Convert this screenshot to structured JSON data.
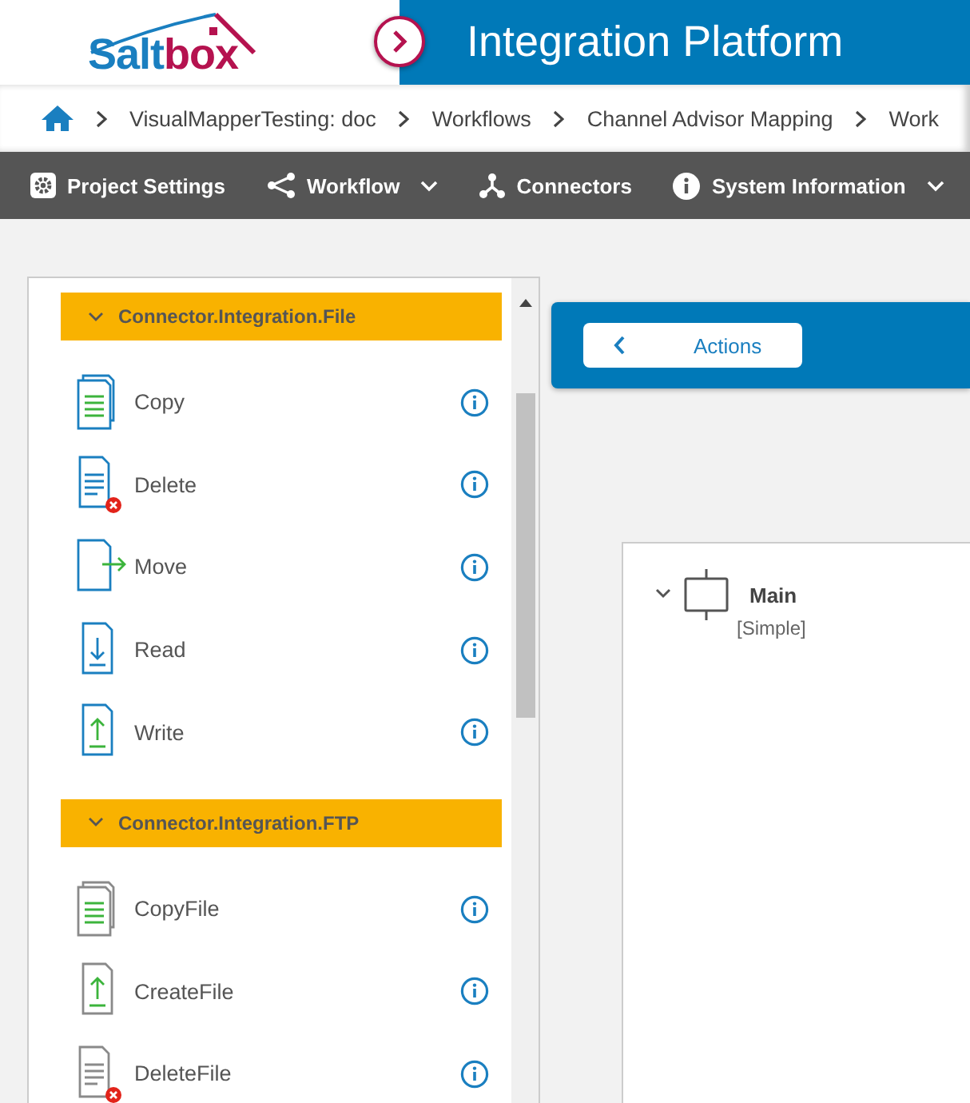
{
  "header": {
    "logo": {
      "part_1": "Salt",
      "part_2": "box"
    },
    "title": "Integration Platform"
  },
  "breadcrumb": [
    "VisualMapperTesting: doc",
    "Workflows",
    "Channel Advisor Mapping",
    "Work"
  ],
  "toolbar": [
    {
      "kind": "settings",
      "label": "Project Settings",
      "dropdown": false
    },
    {
      "kind": "share",
      "label": "Workflow",
      "dropdown": true
    },
    {
      "kind": "connectors",
      "label": "Connectors",
      "dropdown": false
    },
    {
      "kind": "info",
      "label": "System Information",
      "dropdown": true
    }
  ],
  "sidebar": {
    "groups": [
      {
        "title": "Connector.Integration.File",
        "expanded": true,
        "color": "#1a7fc0",
        "items": [
          {
            "label": "Copy",
            "kind": "copy"
          },
          {
            "label": "Delete",
            "kind": "delete"
          },
          {
            "label": "Move",
            "kind": "move"
          },
          {
            "label": "Read",
            "kind": "read"
          },
          {
            "label": "Write",
            "kind": "write"
          }
        ]
      },
      {
        "title": "Connector.Integration.FTP",
        "expanded": true,
        "color": "#8a8a8a",
        "items": [
          {
            "label": "CopyFile",
            "kind": "copy"
          },
          {
            "label": "CreateFile",
            "kind": "write"
          },
          {
            "label": "DeleteFile",
            "kind": "delete"
          }
        ]
      }
    ]
  },
  "actions_bar": {
    "button": "Actions"
  },
  "canvas": {
    "node": {
      "title": "Main",
      "subtitle": "[Simple]",
      "expanded": true
    }
  }
}
